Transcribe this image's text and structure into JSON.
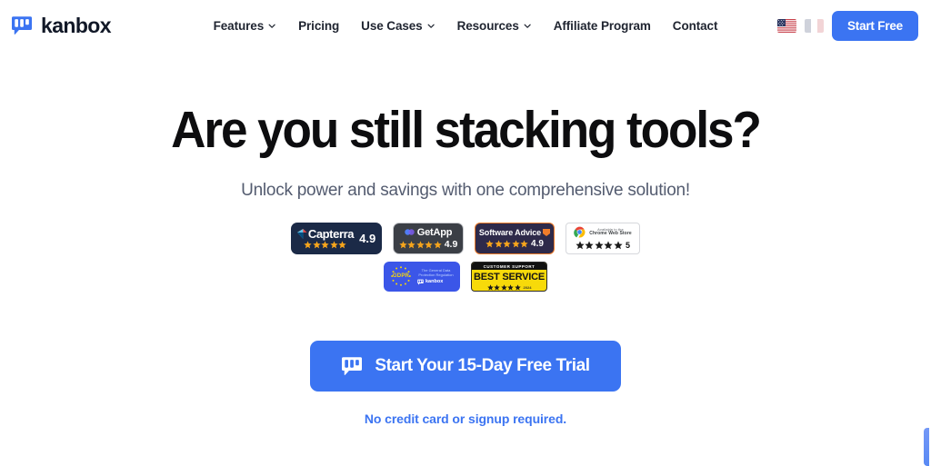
{
  "brand": {
    "name": "kanbox",
    "logo_icon": "kanban-speech-bubble-icon"
  },
  "nav": {
    "items": [
      {
        "label": "Features",
        "has_dropdown": true
      },
      {
        "label": "Pricing",
        "has_dropdown": false
      },
      {
        "label": "Use Cases",
        "has_dropdown": true
      },
      {
        "label": "Resources",
        "has_dropdown": true
      },
      {
        "label": "Affiliate Program",
        "has_dropdown": false
      },
      {
        "label": "Contact",
        "has_dropdown": false
      }
    ]
  },
  "header": {
    "languages": [
      {
        "code": "en",
        "name": "United States",
        "active": true
      },
      {
        "code": "fr",
        "name": "France",
        "active": false
      }
    ],
    "start_free_label": "Start Free"
  },
  "hero": {
    "title": "Are you still stacking tools?",
    "subtitle": "Unlock power and savings with one comprehensive solution!"
  },
  "badges": {
    "row1": [
      {
        "id": "capterra",
        "name": "Capterra",
        "score": "4.9",
        "stars": 5
      },
      {
        "id": "getapp",
        "name": "GetApp",
        "score": "4.9",
        "stars": 5
      },
      {
        "id": "software-advice",
        "name": "Software Advice",
        "score": "4.9",
        "stars": 5
      },
      {
        "id": "chrome-web-store",
        "line1": "Available in the",
        "line2": "Chrome Web Store",
        "score": "5",
        "stars": 5
      }
    ],
    "row2": [
      {
        "id": "gdpr",
        "label": "GDPR",
        "line1": "The General Data Protection Regulation",
        "brand": "kanbox"
      },
      {
        "id": "best-service",
        "heading": "CUSTOMER SUPPORT",
        "title": "BEST SERVICE",
        "year": "2024",
        "stars": 5
      }
    ]
  },
  "cta": {
    "button_label": "Start Your 15-Day Free Trial",
    "button_icon": "kanban-speech-bubble-icon",
    "note": "No credit card or signup required."
  },
  "colors": {
    "accent_blue": "#3b74f2",
    "star_orange": "#f6a51c",
    "text_dark": "#0d0d0f",
    "text_muted": "#545c70",
    "gdpr_blue": "#3b56e8",
    "best_yellow": "#f7da0a"
  }
}
